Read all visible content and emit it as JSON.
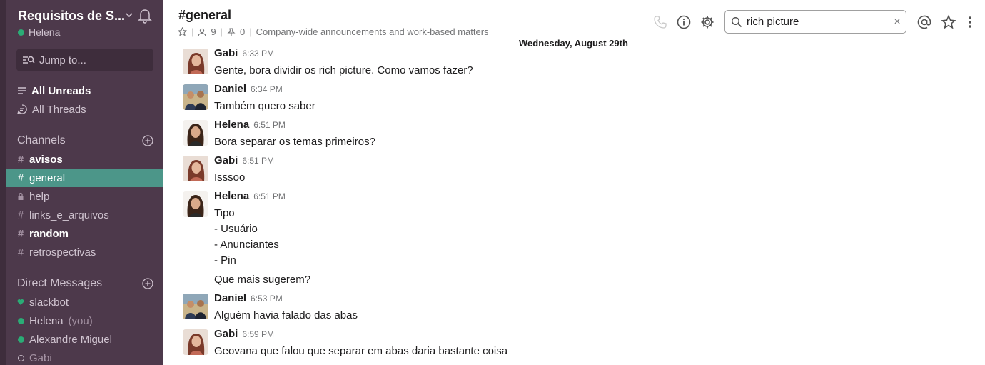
{
  "workspace": {
    "name": "Requisitos de S...",
    "user": "Helena"
  },
  "sidebar": {
    "jump_placeholder": "Jump to...",
    "all_unreads": "All Unreads",
    "all_threads": "All Threads",
    "channels_header": "Channels",
    "channels": [
      {
        "prefix": "#",
        "name": "avisos",
        "bold": true
      },
      {
        "prefix": "#",
        "name": "general",
        "active": true
      },
      {
        "prefix": "lock",
        "name": "help"
      },
      {
        "prefix": "#",
        "name": "links_e_arquivos"
      },
      {
        "prefix": "#",
        "name": "random",
        "bold": true
      },
      {
        "prefix": "#",
        "name": "retrospectivas"
      }
    ],
    "dm_header": "Direct Messages",
    "dms": [
      {
        "name": "slackbot",
        "status": "heart"
      },
      {
        "name": "Helena",
        "suffix": "(you)",
        "status": "online"
      },
      {
        "name": "Alexandre Miguel",
        "status": "online"
      },
      {
        "name": "Gabi",
        "status": "away"
      }
    ]
  },
  "header": {
    "channel_title": "#general",
    "members_count": "9",
    "pinned_count": "0",
    "topic": "Company-wide announcements and work-based matters",
    "search_value": "rich picture",
    "search_clear": "×"
  },
  "day_divider": "Wednesday, August 29th",
  "messages": [
    {
      "author": "Gabi",
      "time": "6:33 PM",
      "lines": [
        "Gente, bora dividir os rich picture. Como vamos fazer?"
      ]
    },
    {
      "author": "Daniel",
      "time": "6:34 PM",
      "lines": [
        "Também quero saber"
      ]
    },
    {
      "author": "Helena",
      "time": "6:51 PM",
      "lines": [
        "Bora separar os temas primeiros?"
      ]
    },
    {
      "author": "Gabi",
      "time": "6:51 PM",
      "lines": [
        "Isssoo"
      ]
    },
    {
      "author": "Helena",
      "time": "6:51 PM",
      "lines": [
        "Tipo",
        "- Usuário",
        "- Anunciantes",
        "- Pin",
        "Que mais sugerem?"
      ]
    },
    {
      "author": "Daniel",
      "time": "6:53 PM",
      "lines": [
        "Alguém havia falado das abas"
      ]
    },
    {
      "author": "Gabi",
      "time": "6:59 PM",
      "lines": [
        "Geovana que falou que separar em abas daria bastante coisa"
      ]
    }
  ],
  "colors": {
    "sidebar_bg": "#4d394b",
    "active_channel": "#4c9689",
    "online": "#2bac76"
  }
}
